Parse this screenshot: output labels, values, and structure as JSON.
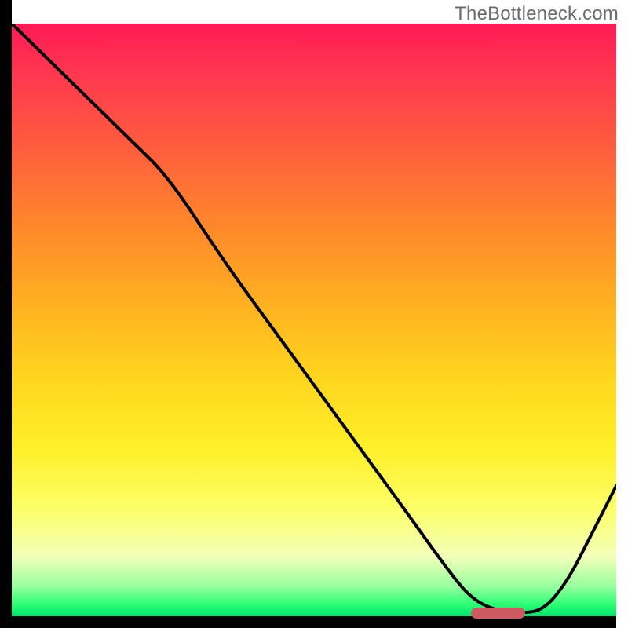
{
  "watermark": "TheBottleneck.com",
  "colors": {
    "axis": "#000000",
    "curve": "#000000",
    "marker": "#cc5a60",
    "gradient_top": "#ff1a55",
    "gradient_bottom": "#00e36b"
  },
  "chart_data": {
    "type": "line",
    "title": "",
    "xlabel": "",
    "ylabel": "",
    "xlim": [
      0,
      100
    ],
    "ylim": [
      0,
      100
    ],
    "x": [
      0,
      5,
      12,
      20,
      26,
      35,
      45,
      55,
      65,
      72,
      76,
      80,
      84,
      88,
      92,
      96,
      100
    ],
    "values": [
      100,
      95,
      88,
      80,
      74,
      60,
      46,
      32,
      18,
      8,
      3,
      1,
      0.5,
      1,
      6,
      14,
      22
    ],
    "marker": {
      "x_start": 76,
      "x_end": 85,
      "y": 0.5
    },
    "annotations": []
  }
}
